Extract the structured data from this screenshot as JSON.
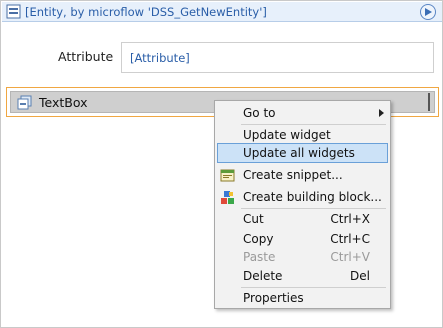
{
  "dataview": {
    "title": "[Entity, by microflow 'DSS_GetNewEntity']",
    "icon": "dataview-icon",
    "run_icon": "play-circle-icon"
  },
  "form": {
    "attribute_label": "Attribute",
    "attribute_value": "[Attribute]"
  },
  "textbox": {
    "label": "TextBox",
    "icon": "textbox-icon"
  },
  "context_menu": {
    "items": [
      {
        "label": "Go to",
        "shortcut": "",
        "submenu": true,
        "disabled": false,
        "highlighted": false,
        "icon": ""
      },
      {
        "label": "Update widget",
        "shortcut": "",
        "submenu": false,
        "disabled": false,
        "highlighted": false,
        "icon": ""
      },
      {
        "label": "Update all widgets",
        "shortcut": "",
        "submenu": false,
        "disabled": false,
        "highlighted": true,
        "icon": ""
      },
      {
        "label": "Create snippet...",
        "shortcut": "",
        "submenu": false,
        "disabled": false,
        "highlighted": false,
        "icon": "snippet-icon"
      },
      {
        "label": "Create building block...",
        "shortcut": "",
        "submenu": false,
        "disabled": false,
        "highlighted": false,
        "icon": "building-block-icon"
      },
      {
        "label": "Cut",
        "shortcut": "Ctrl+X",
        "submenu": false,
        "disabled": false,
        "highlighted": false,
        "icon": ""
      },
      {
        "label": "Copy",
        "shortcut": "Ctrl+C",
        "submenu": false,
        "disabled": false,
        "highlighted": false,
        "icon": ""
      },
      {
        "label": "Paste",
        "shortcut": "Ctrl+V",
        "submenu": false,
        "disabled": true,
        "highlighted": false,
        "icon": ""
      },
      {
        "label": "Delete",
        "shortcut": "Del",
        "submenu": false,
        "disabled": false,
        "highlighted": false,
        "icon": ""
      },
      {
        "label": "Properties",
        "shortcut": "",
        "submenu": false,
        "disabled": false,
        "highlighted": false,
        "icon": ""
      }
    ]
  },
  "colors": {
    "selection_border": "#f0a742",
    "highlight_bg": "#cce2f7",
    "link_blue": "#2a5ea8"
  }
}
